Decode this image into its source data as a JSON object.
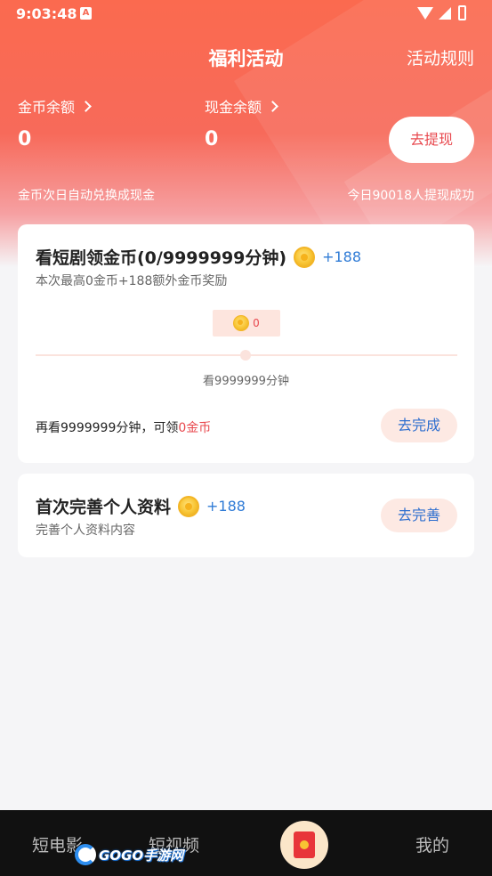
{
  "status_bar": {
    "time": "9:03:48",
    "notif_glyph": "A"
  },
  "header": {
    "title": "福利活动",
    "rules_link": "活动规则"
  },
  "balance": {
    "coin_label": "金币余额",
    "coin_value": "0",
    "cash_label": "现金余额",
    "cash_value": "0",
    "withdraw_button": "去提现",
    "hint_left": "金币次日自动兑换成现金",
    "hint_right": "今日90018人提现成功"
  },
  "tasks": [
    {
      "title": "看短剧领金币(0/9999999分钟)",
      "bonus": "+188",
      "subtitle": "本次最高0金币+188额外金币奖励",
      "progress_coins": "0",
      "progress": 0,
      "track_label": "看9999999分钟",
      "reward_prefix": "再看9999999分钟，可领",
      "reward_amount": "0金币",
      "button": "去完成"
    },
    {
      "title": "首次完善个人资料",
      "bonus": "+188",
      "subtitle": "完善个人资料内容",
      "button": "去完善"
    }
  ],
  "tabbar": {
    "items": [
      "短电影",
      "短视频",
      "我的"
    ],
    "center_icon": "red-packet-icon"
  },
  "watermark": {
    "text": "GOGO手游网"
  },
  "colors": {
    "accent_red": "#e8484e",
    "bonus_blue": "#2f7bd6",
    "hero_top": "#fb6a4f"
  }
}
